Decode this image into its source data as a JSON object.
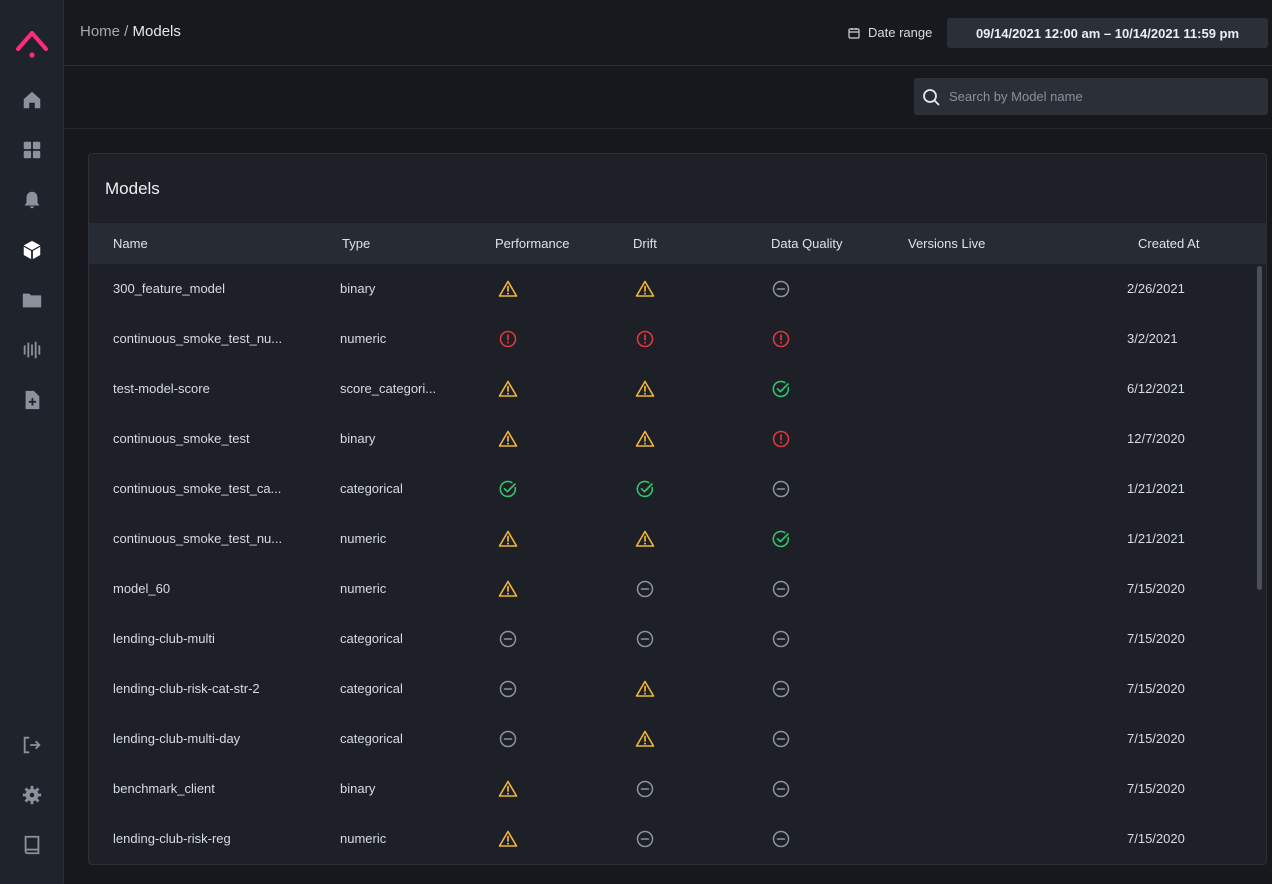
{
  "breadcrumb": {
    "home": "Home",
    "separator": " / ",
    "current": "Models"
  },
  "header": {
    "date_label": "Date range",
    "date_value": "09/14/2021 12:00 am – 10/14/2021 11:59 pm"
  },
  "search": {
    "placeholder": "Search by Model name",
    "value": ""
  },
  "card": {
    "title": "Models"
  },
  "columns": [
    "Name",
    "Type",
    "Performance",
    "Drift",
    "Data Quality",
    "Versions Live",
    "Created At"
  ],
  "rows": [
    {
      "name": "300_feature_model",
      "type": "binary",
      "performance": "warning",
      "drift": "warning",
      "data_quality": "none",
      "versions_live": "",
      "created_at": "2/26/2021"
    },
    {
      "name": "continuous_smoke_test_nu...",
      "type": "numeric",
      "performance": "error",
      "drift": "error",
      "data_quality": "error",
      "versions_live": "",
      "created_at": "3/2/2021"
    },
    {
      "name": "test-model-score",
      "type": "score_categori...",
      "performance": "warning",
      "drift": "warning",
      "data_quality": "ok",
      "versions_live": "",
      "created_at": "6/12/2021"
    },
    {
      "name": "continuous_smoke_test",
      "type": "binary",
      "performance": "warning",
      "drift": "warning",
      "data_quality": "error",
      "versions_live": "",
      "created_at": "12/7/2020"
    },
    {
      "name": "continuous_smoke_test_ca...",
      "type": "categorical",
      "performance": "ok",
      "drift": "ok",
      "data_quality": "none",
      "versions_live": "",
      "created_at": "1/21/2021"
    },
    {
      "name": "continuous_smoke_test_nu...",
      "type": "numeric",
      "performance": "warning",
      "drift": "warning",
      "data_quality": "ok",
      "versions_live": "",
      "created_at": "1/21/2021"
    },
    {
      "name": "model_60",
      "type": "numeric",
      "performance": "warning",
      "drift": "none",
      "data_quality": "none",
      "versions_live": "",
      "created_at": "7/15/2020"
    },
    {
      "name": "lending-club-multi",
      "type": "categorical",
      "performance": "none",
      "drift": "none",
      "data_quality": "none",
      "versions_live": "",
      "created_at": "7/15/2020"
    },
    {
      "name": "lending-club-risk-cat-str-2",
      "type": "categorical",
      "performance": "none",
      "drift": "warning",
      "data_quality": "none",
      "versions_live": "",
      "created_at": "7/15/2020"
    },
    {
      "name": "lending-club-multi-day",
      "type": "categorical",
      "performance": "none",
      "drift": "warning",
      "data_quality": "none",
      "versions_live": "",
      "created_at": "7/15/2020"
    },
    {
      "name": "benchmark_client",
      "type": "binary",
      "performance": "warning",
      "drift": "none",
      "data_quality": "none",
      "versions_live": "",
      "created_at": "7/15/2020"
    },
    {
      "name": "lending-club-risk-reg",
      "type": "numeric",
      "performance": "warning",
      "drift": "none",
      "data_quality": "none",
      "versions_live": "",
      "created_at": "7/15/2020"
    }
  ],
  "sidebar": {
    "items": [
      {
        "icon": "home-icon"
      },
      {
        "icon": "dashboard-grid-icon"
      },
      {
        "icon": "bell-icon"
      },
      {
        "icon": "cube-icon"
      },
      {
        "icon": "folder-icon"
      },
      {
        "icon": "bars-icon"
      },
      {
        "icon": "file-plus-icon"
      }
    ],
    "bottom_items": [
      {
        "icon": "logout-icon"
      },
      {
        "icon": "settings-gear-icon"
      },
      {
        "icon": "book-icon"
      }
    ]
  },
  "colors": {
    "brand": "#ff2d78",
    "warning": "#f2b53a",
    "error": "#e0363d",
    "ok": "#35c26a",
    "none": "#8d939c"
  }
}
